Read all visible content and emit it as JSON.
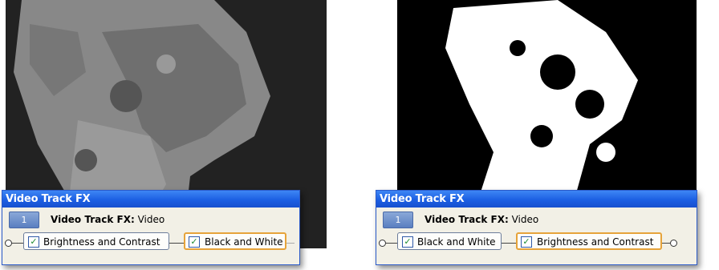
{
  "panels": [
    {
      "window_title": "Video Track FX",
      "track_number": "1",
      "fx_label_bold": "Video Track FX:",
      "fx_label_name": "Video",
      "chain": [
        {
          "label": "Brightness and Contrast",
          "checked": true,
          "selected": false
        },
        {
          "label": "Black and White",
          "checked": true,
          "selected": true
        }
      ]
    },
    {
      "window_title": "Video Track FX",
      "track_number": "1",
      "fx_label_bold": "Video Track FX:",
      "fx_label_name": "Video",
      "chain": [
        {
          "label": "Black and White",
          "checked": true,
          "selected": false
        },
        {
          "label": "Brightness and Contrast",
          "checked": true,
          "selected": true
        }
      ]
    }
  ],
  "icons": {
    "checkbox": "check-icon"
  },
  "colors": {
    "titlebar": "#1c5fe3",
    "selected_border": "#e6a33a",
    "window_bg": "#f2f0e6"
  }
}
